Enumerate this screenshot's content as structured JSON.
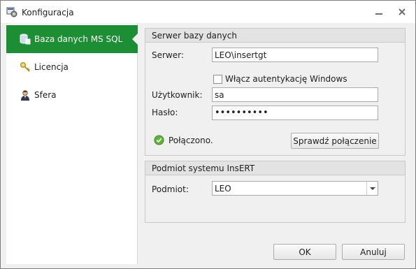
{
  "window": {
    "title": "Konfiguracja",
    "accent": "#1c8f35"
  },
  "sidebar": {
    "items": [
      {
        "label": "Baza danych MS SQL",
        "icon": "database-icon",
        "active": true
      },
      {
        "label": "Licencja",
        "icon": "key-icon",
        "active": false
      },
      {
        "label": "Sfera",
        "icon": "user-icon",
        "active": false
      }
    ]
  },
  "server_group": {
    "header": "Serwer bazy danych",
    "server_label": "Serwer:",
    "server_value": "LEO\\insertgt",
    "windows_auth_label": "Włącz autentykację Windows",
    "windows_auth_checked": false,
    "user_label": "Użytkownik:",
    "user_value": "sa",
    "password_label": "Hasło:",
    "password_value": "••••••••••",
    "status_text": "Połączono.",
    "status_icon": "check-circle-icon",
    "test_button": "Sprawdź połączenie"
  },
  "subject_group": {
    "header": "Podmiot systemu InsERT",
    "subject_label": "Podmiot:",
    "subject_value": "LEO"
  },
  "footer": {
    "ok": "OK",
    "cancel": "Anuluj"
  }
}
